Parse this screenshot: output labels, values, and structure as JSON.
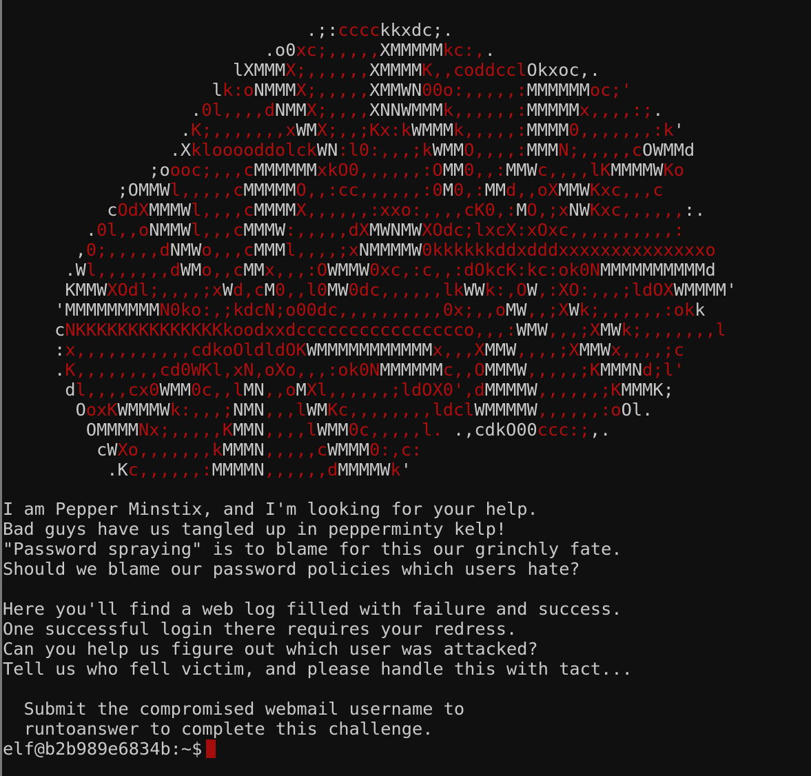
{
  "theme": {
    "background": "#101010",
    "foreground": "#c9c9c9",
    "accent_red": "#b00d0d",
    "cursor": "#a50d0d"
  },
  "ascii_art": [
    [
      [
        "w",
        "                             .;:"
      ],
      [
        "r",
        "cccc"
      ],
      [
        "w",
        "kkxdc;."
      ]
    ],
    [
      [
        "w",
        "                         .o0"
      ],
      [
        "r",
        "xc;,,,,,"
      ],
      [
        "w",
        "XMMMMM"
      ],
      [
        "r",
        "kc:,"
      ],
      [
        "w",
        "."
      ]
    ],
    [
      [
        "w",
        "                      lXMMM"
      ],
      [
        "r",
        "X;,,,,,,"
      ],
      [
        "w",
        "XMMMM"
      ],
      [
        "r",
        "K,,coddccl"
      ],
      [
        "w",
        "Okxoc,."
      ]
    ],
    [
      [
        "w",
        "                    l"
      ],
      [
        "r",
        "k:o"
      ],
      [
        "w",
        "NMMM"
      ],
      [
        "r",
        "X;,,,,,"
      ],
      [
        "w",
        "XMMWN"
      ],
      [
        "r",
        "00o:,,,,,:"
      ],
      [
        "w",
        "MMMMMM"
      ],
      [
        "r",
        "oc;'"
      ]
    ],
    [
      [
        "w",
        "                  ."
      ],
      [
        "r",
        "0l,,,,d"
      ],
      [
        "w",
        "NMM"
      ],
      [
        "r",
        "X;,,,,"
      ],
      [
        "w",
        "XNNWMMM"
      ],
      [
        "r",
        "k,,,,,,:"
      ],
      [
        "w",
        "MMMMM"
      ],
      [
        "r",
        "x,,,,:;"
      ],
      [
        "w",
        "."
      ]
    ],
    [
      [
        "w",
        "                 ."
      ],
      [
        "r",
        "K;,,,,,,,x"
      ],
      [
        "w",
        "WM"
      ],
      [
        "r",
        "X;,,;Kx:k"
      ],
      [
        "w",
        "WMMM"
      ],
      [
        "r",
        "k,,,,,:"
      ],
      [
        "w",
        "MMMM"
      ],
      [
        "r",
        "0,,,,,,,:k"
      ],
      [
        "w",
        "'"
      ]
    ],
    [
      [
        "w",
        "                .X"
      ],
      [
        "r",
        "klooooddolck"
      ],
      [
        "w",
        "WN"
      ],
      [
        "r",
        ":l0:,,,;k"
      ],
      [
        "w",
        "WMM"
      ],
      [
        "r",
        "O,,,,:"
      ],
      [
        "w",
        "MMM"
      ],
      [
        "r",
        "N;,,,,,c"
      ],
      [
        "w",
        "OWMMd"
      ]
    ],
    [
      [
        "w",
        "              ;o"
      ],
      [
        "r",
        "ooc;,,,c"
      ],
      [
        "w",
        "MMMMMM"
      ],
      [
        "r",
        "xkO0,,,,,,:O"
      ],
      [
        "w",
        "MM"
      ],
      [
        "r",
        "0,,:"
      ],
      [
        "w",
        "MMW"
      ],
      [
        "r",
        "c,,,,lK"
      ],
      [
        "w",
        "MMMMW"
      ],
      [
        "r",
        "Ko"
      ]
    ],
    [
      [
        "w",
        "           ;OMMW"
      ],
      [
        "r",
        "l,,,,,c"
      ],
      [
        "w",
        "MMMMM"
      ],
      [
        "r",
        "O,,:cc,,,,,,:0"
      ],
      [
        "w",
        "M"
      ],
      [
        "r",
        "0,:"
      ],
      [
        "w",
        "MM"
      ],
      [
        "r",
        "d,,oX"
      ],
      [
        "w",
        "MMW"
      ],
      [
        "r",
        "Kxc,,,c"
      ]
    ],
    [
      [
        "w",
        "          c"
      ],
      [
        "r",
        "OdX"
      ],
      [
        "w",
        "MMMW"
      ],
      [
        "r",
        "l,,,,c"
      ],
      [
        "w",
        "MMMM"
      ],
      [
        "r",
        "X,,,,,,:xxo:,,,,cK0,:"
      ],
      [
        "w",
        "M"
      ],
      [
        "r",
        "O,;x"
      ],
      [
        "w",
        "NW"
      ],
      [
        "r",
        "Kxc,,,,,,"
      ],
      [
        "w",
        ":."
      ]
    ],
    [
      [
        "w",
        "        ."
      ],
      [
        "r",
        "0l,,o"
      ],
      [
        "w",
        "NMMW"
      ],
      [
        "r",
        "l,,,c"
      ],
      [
        "w",
        "MMMW"
      ],
      [
        "r",
        ":,,,,,dX"
      ],
      [
        "w",
        "MWNMW"
      ],
      [
        "r",
        "XOdc;lxcX:xOxc,,,,,,,,,,:"
      ]
    ],
    [
      [
        "w",
        "       ,"
      ],
      [
        "r",
        "0;,,,,,d"
      ],
      [
        "w",
        "NMW"
      ],
      [
        "r",
        "o,,,c"
      ],
      [
        "w",
        "MMM"
      ],
      [
        "r",
        "l,,,,;x"
      ],
      [
        "w",
        "NMMMMW"
      ],
      [
        "r",
        "0kkkkkkddxdddxxxxxxxxxxxxxxo"
      ]
    ],
    [
      [
        "w",
        "      .W"
      ],
      [
        "r",
        "l,,,,,,,d"
      ],
      [
        "w",
        "WM"
      ],
      [
        "r",
        "o,,c"
      ],
      [
        "w",
        "MM"
      ],
      [
        "r",
        "x,,,:O"
      ],
      [
        "w",
        "WMMW"
      ],
      [
        "r",
        "0xc,:c,,:dOkcK:kc:ok0N"
      ],
      [
        "w",
        "MMMMMMMMMMd"
      ]
    ],
    [
      [
        "w",
        "      KMMW"
      ],
      [
        "r",
        "XOdl;,,,,;x"
      ],
      [
        "w",
        "W"
      ],
      [
        "r",
        "d,c"
      ],
      [
        "w",
        "M"
      ],
      [
        "r",
        "0,,l0"
      ],
      [
        "w",
        "MW"
      ],
      [
        "r",
        "0dc,,,,,,lk"
      ],
      [
        "w",
        "WW"
      ],
      [
        "r",
        "k:,O"
      ],
      [
        "w",
        "W"
      ],
      [
        "r",
        ",:XO:,,,;ldOX"
      ],
      [
        "w",
        "WMMMM'"
      ]
    ],
    [
      [
        "w",
        "     'MMMMMMMMM"
      ],
      [
        "r",
        "N0ko:,;kdcN;o00dc,,,,,,,,,,0x;,,o"
      ],
      [
        "w",
        "MW"
      ],
      [
        "r",
        ",,;X"
      ],
      [
        "w",
        "W"
      ],
      [
        "r",
        "k;,,,,,,:ok"
      ],
      [
        "w",
        "k"
      ]
    ],
    [
      [
        "w",
        "     c"
      ],
      [
        "r",
        "NKKKKKKKKKKKKKKkoodxxdcccccccccccccccco,,,:"
      ],
      [
        "w",
        "WMW"
      ],
      [
        "r",
        ",,,;X"
      ],
      [
        "w",
        "MW"
      ],
      [
        "r",
        "k;,,,,,,,l"
      ]
    ],
    [
      [
        "w",
        "     :"
      ],
      [
        "r",
        "x,,,,,,,,,,,cdkoOldldOK"
      ],
      [
        "w",
        "WMMMMMMMMMMM"
      ],
      [
        "r",
        "x,,,X"
      ],
      [
        "w",
        "MMW"
      ],
      [
        "r",
        ",,,,;X"
      ],
      [
        "w",
        "MMW"
      ],
      [
        "r",
        "x,,,,;c"
      ]
    ],
    [
      [
        "w",
        "     ."
      ],
      [
        "r",
        "K,,,,,,,,cd0WKl,xN,oXo,,,:ok0N"
      ],
      [
        "w",
        "MMMMMM"
      ],
      [
        "r",
        "c,,O"
      ],
      [
        "w",
        "MMMW"
      ],
      [
        "r",
        ",,,,,;K"
      ],
      [
        "w",
        "MMMN"
      ],
      [
        "r",
        "d;l'"
      ]
    ],
    [
      [
        "w",
        "      d"
      ],
      [
        "r",
        "l,,,,cx0"
      ],
      [
        "w",
        "WMM"
      ],
      [
        "r",
        "0c,,l"
      ],
      [
        "w",
        "MN"
      ],
      [
        "r",
        ",,o"
      ],
      [
        "w",
        "M"
      ],
      [
        "r",
        "Xl,,,,,,;ldOX0',d"
      ],
      [
        "w",
        "MMMMW"
      ],
      [
        "r",
        ",,,,,,;K"
      ],
      [
        "w",
        "MMMK;"
      ]
    ],
    [
      [
        "w",
        "       O"
      ],
      [
        "r",
        "oxK"
      ],
      [
        "w",
        "WMMMW"
      ],
      [
        "r",
        "k:,,,;"
      ],
      [
        "w",
        "NMN"
      ],
      [
        "r",
        ",,,l"
      ],
      [
        "w",
        "WM"
      ],
      [
        "r",
        "Kc,,,,,,,,ldcl"
      ],
      [
        "w",
        "WMMMMW"
      ],
      [
        "r",
        ",,,,,,:o"
      ],
      [
        "w",
        "Ol."
      ]
    ],
    [
      [
        "w",
        "        OMMMM"
      ],
      [
        "r",
        "Nx;,,,,,K"
      ],
      [
        "w",
        "MMN"
      ],
      [
        "r",
        ",,,,l"
      ],
      [
        "w",
        "WMM"
      ],
      [
        "r",
        "0c,,,,,l."
      ],
      [
        "w",
        " .,cdkO00"
      ],
      [
        "r",
        "ccc:;"
      ],
      [
        "w",
        ",."
      ]
    ],
    [
      [
        "w",
        "         cW"
      ],
      [
        "r",
        "Xo,,,,,,,k"
      ],
      [
        "w",
        "MMMN"
      ],
      [
        "r",
        ",,,,,c"
      ],
      [
        "w",
        "WMMM"
      ],
      [
        "r",
        "0:,c:"
      ]
    ],
    [
      [
        "w",
        "          .K"
      ],
      [
        "r",
        "c,,,,,,:"
      ],
      [
        "w",
        "MMMMN"
      ],
      [
        "r",
        ",,,,,,d"
      ],
      [
        "w",
        "MMMMW"
      ],
      [
        "r",
        "k"
      ],
      [
        "w",
        "'"
      ]
    ]
  ],
  "message": {
    "lines": [
      "I am Pepper Minstix, and I'm looking for your help.",
      "Bad guys have us tangled up in pepperminty kelp!",
      "\"Password spraying\" is to blame for this our grinchly fate.",
      "Should we blame our password policies which users hate?",
      "",
      "Here you'll find a web log filled with failure and success.",
      "One successful login there requires your redress.",
      "Can you help us figure out which user was attacked?",
      "Tell us who fell victim, and please handle this with tact...",
      "",
      "  Submit the compromised webmail username to",
      "  runtoanswer to complete this challenge."
    ]
  },
  "prompt": {
    "text": "elf@b2b989e6834b:~$"
  }
}
